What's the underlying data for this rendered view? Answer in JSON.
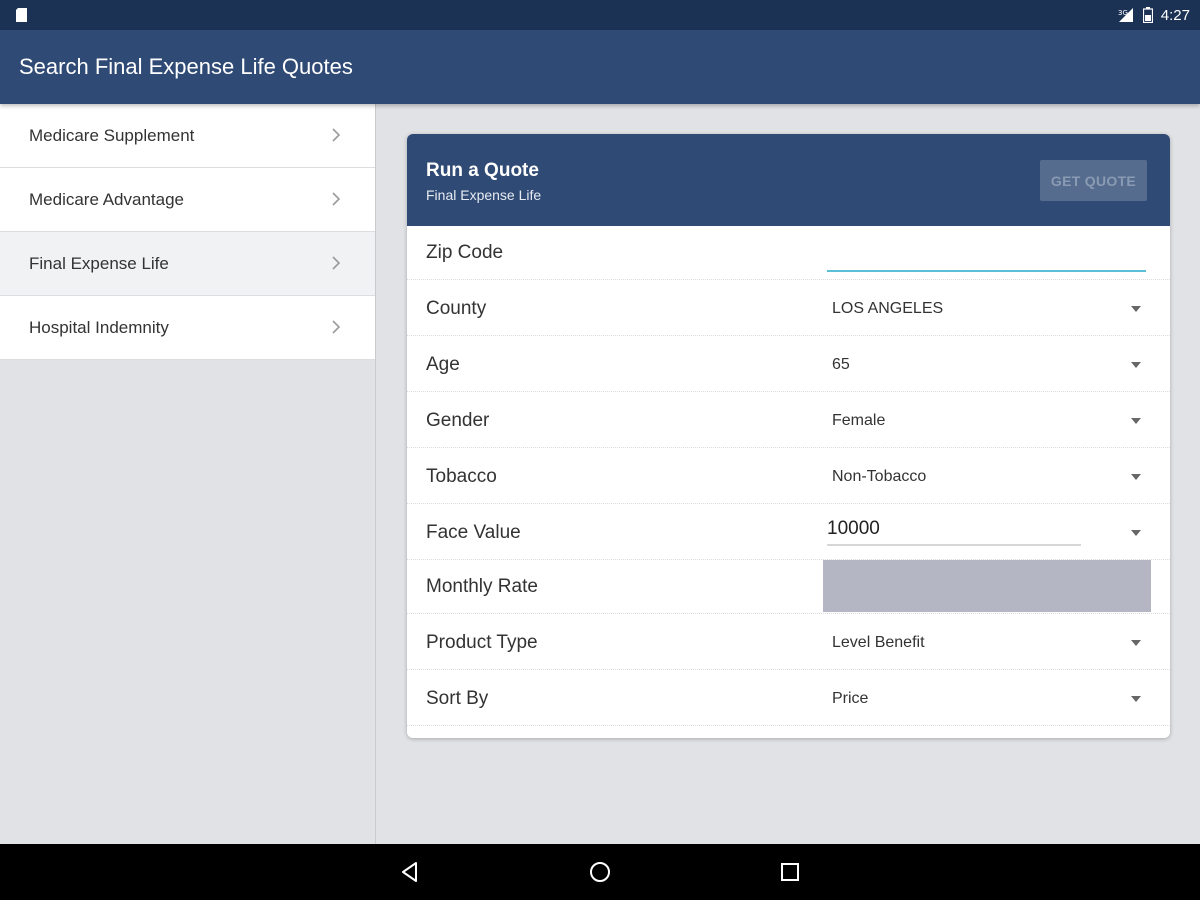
{
  "status_bar": {
    "time": "4:27"
  },
  "app_bar": {
    "title": "Search Final Expense Life Quotes"
  },
  "sidebar": {
    "items": [
      {
        "label": "Medicare Supplement"
      },
      {
        "label": "Medicare Advantage"
      },
      {
        "label": "Final Expense Life",
        "selected": true
      },
      {
        "label": "Hospital Indemnity"
      }
    ]
  },
  "quote_card": {
    "title": "Run a Quote",
    "subtitle": "Final Expense Life",
    "get_quote_label": "GET QUOTE",
    "fields": {
      "zip": {
        "label": "Zip Code",
        "value": ""
      },
      "county": {
        "label": "County",
        "value": "LOS ANGELES"
      },
      "age": {
        "label": "Age",
        "value": "65"
      },
      "gender": {
        "label": "Gender",
        "value": "Female"
      },
      "tobacco": {
        "label": "Tobacco",
        "value": "Non-Tobacco"
      },
      "face_value": {
        "label": "Face Value",
        "value": "10000"
      },
      "monthly_rate": {
        "label": "Monthly Rate",
        "value": ""
      },
      "product_type": {
        "label": "Product Type",
        "value": "Level Benefit"
      },
      "sort_by": {
        "label": "Sort By",
        "value": "Price"
      }
    }
  },
  "colors": {
    "status_bar": "#1c3255",
    "app_bar": "#2f4a74",
    "input_focus": "#5cbfd8",
    "rate_box": "#b4b7c3"
  }
}
